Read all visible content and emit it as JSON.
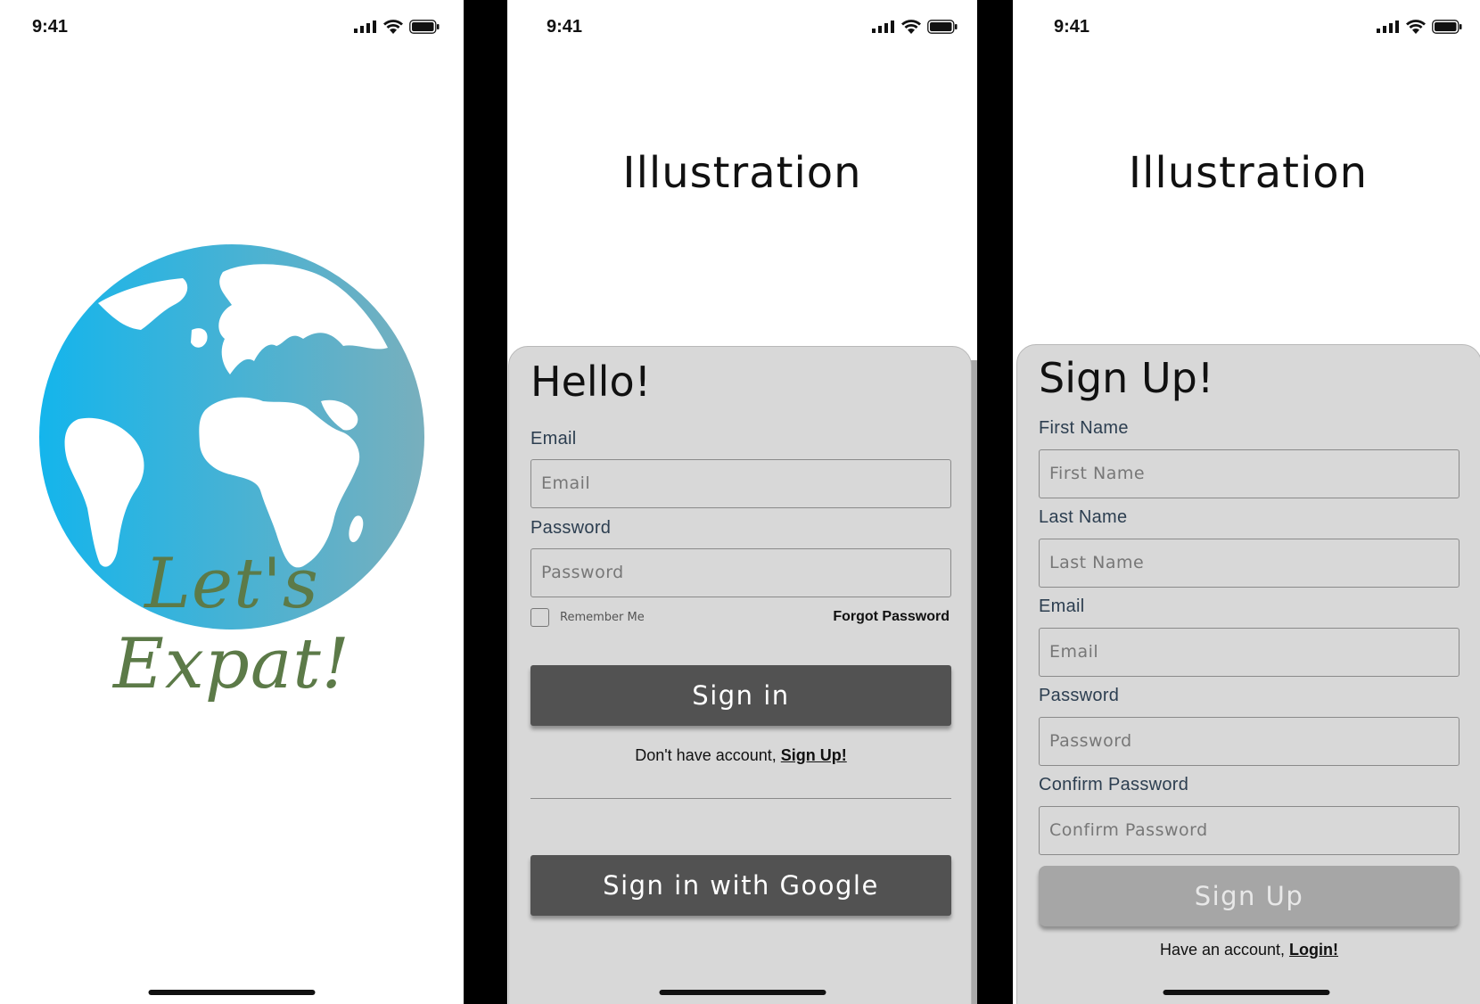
{
  "status": {
    "time": "9:41"
  },
  "splash": {
    "logo_text": "Let's Expat!"
  },
  "signin": {
    "illustration": "Illustration",
    "heading": "Hello!",
    "email_label": "Email",
    "email_placeholder": "Email",
    "password_label": "Password",
    "password_placeholder": "Password",
    "remember_me": "Remember Me",
    "forgot_password": "Forgot Password",
    "signin_button": "Sign in",
    "no_account_text": "Don't have account, ",
    "signup_link": "Sign Up!",
    "google_button": "Sign in with Google"
  },
  "signup": {
    "illustration": "Illustration",
    "heading": "Sign Up!",
    "first_name_label": "First Name",
    "first_name_placeholder": "First Name",
    "last_name_label": "Last Name",
    "last_name_placeholder": "Last Name",
    "email_label": "Email",
    "email_placeholder": "Email",
    "password_label": "Password",
    "password_placeholder": "Password",
    "confirm_label": "Confirm Password",
    "confirm_placeholder": "Confirm Password",
    "signup_button": "Sign Up",
    "have_account_text": "Have an account, ",
    "login_link": "Login!"
  },
  "colors": {
    "globe": "#1fb3e8",
    "logo_text": "#5c7a48",
    "card": "#d8d8d8",
    "button": "#525252"
  }
}
